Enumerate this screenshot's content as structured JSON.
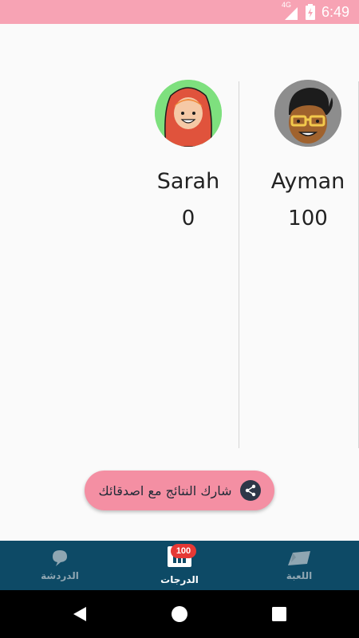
{
  "status_bar": {
    "time": "6:49",
    "network": "4G"
  },
  "players": [
    {
      "name": "Ayman",
      "score": "100",
      "avatar_icon": "man-glasses-avatar-icon"
    },
    {
      "name": "Sarah",
      "score": "0",
      "avatar_icon": "woman-hijab-avatar-icon"
    }
  ],
  "share_button": {
    "label": "شارك النتائج مع اصدقائك",
    "icon": "share-icon"
  },
  "bottom_nav": {
    "items": [
      {
        "label": "اللعبة",
        "icon": "map-icon",
        "active": false
      },
      {
        "label": "الدرجات",
        "icon": "scores-icon",
        "active": true,
        "badge": "100"
      },
      {
        "label": "الدردشة",
        "icon": "chat-icon",
        "active": false
      }
    ]
  },
  "colors": {
    "status_bar": "#f7a3b4",
    "accent": "#f48fa3",
    "nav_bg": "#0d4a66",
    "badge": "#e53935"
  }
}
